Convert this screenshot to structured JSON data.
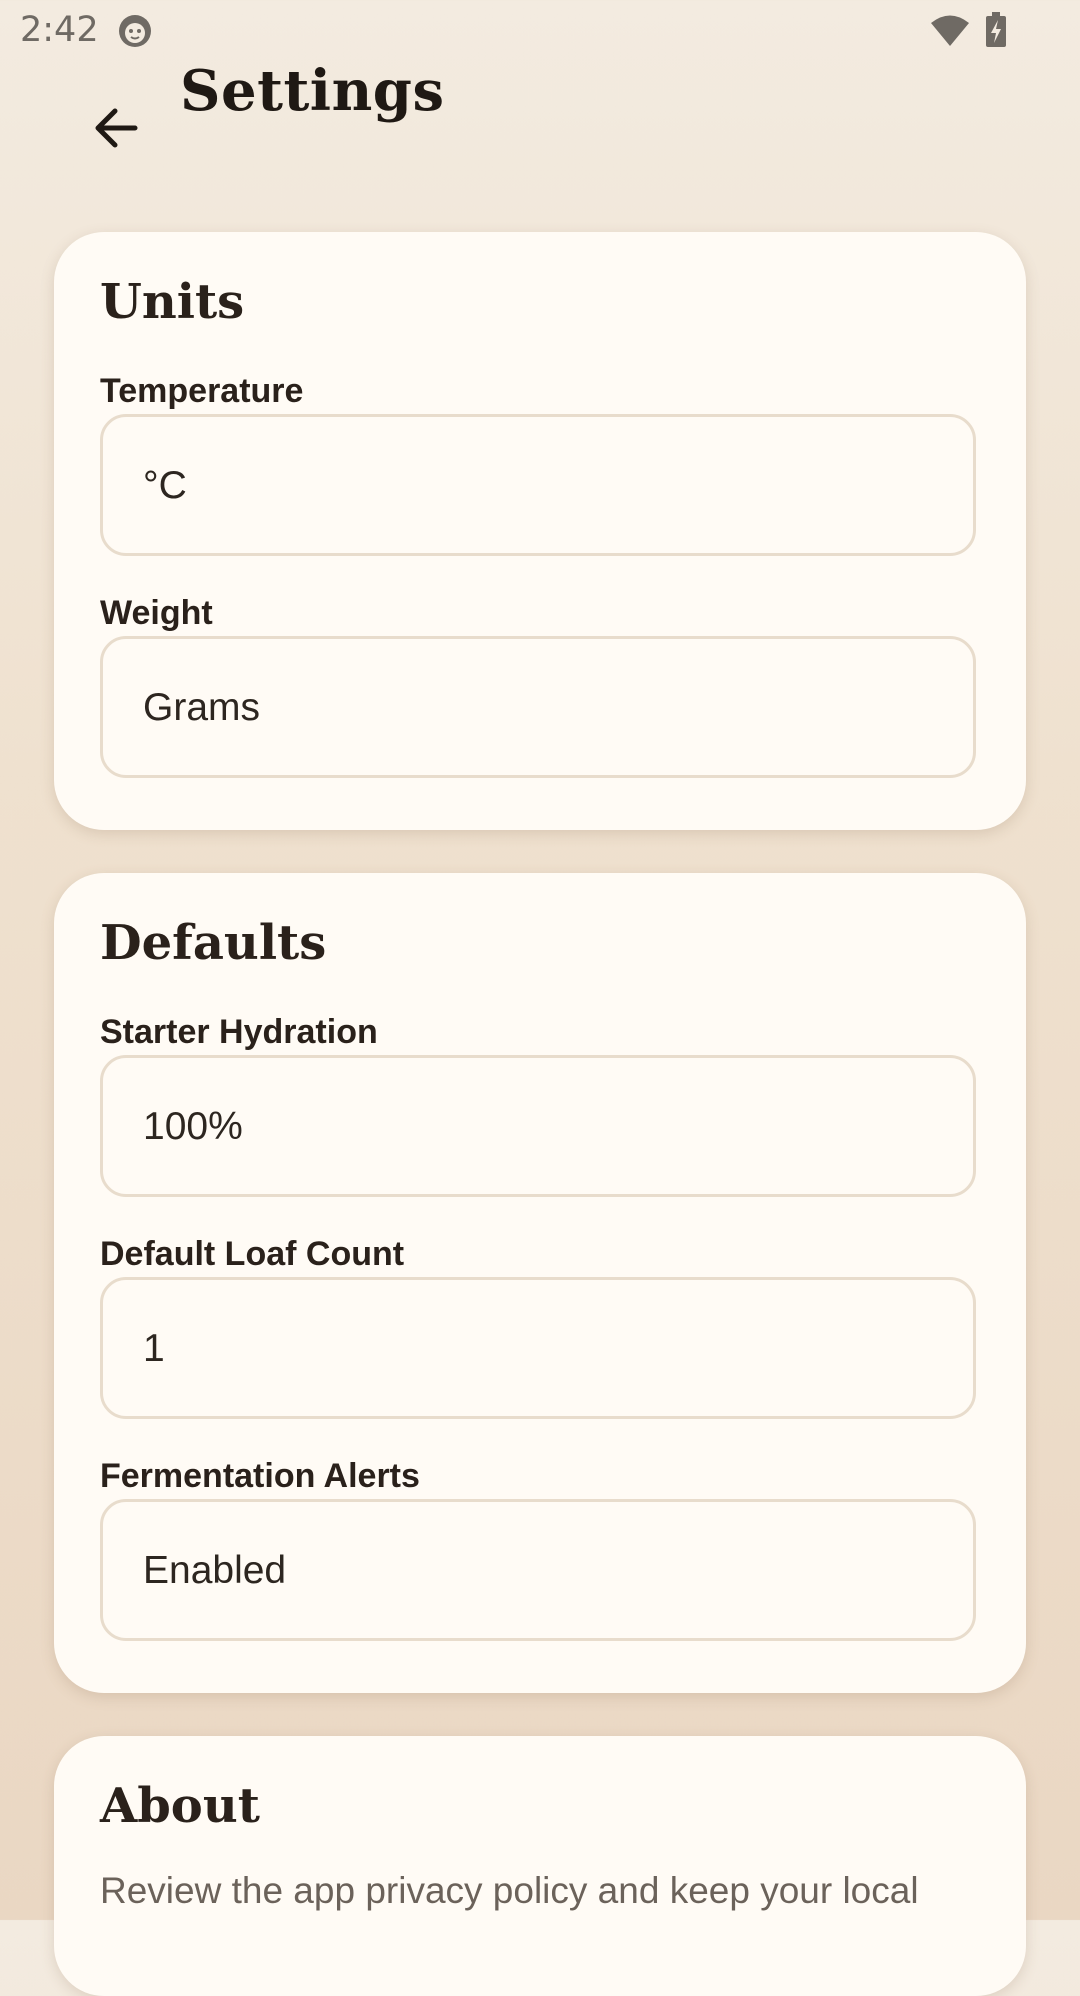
{
  "status_bar": {
    "time": "2:42",
    "icons": [
      "app-notification-icon",
      "wifi-icon",
      "battery-charging-icon"
    ]
  },
  "header": {
    "title": "Settings",
    "back_icon": "arrow-left-icon"
  },
  "sections": {
    "units": {
      "title": "Units",
      "temperature": {
        "label": "Temperature",
        "value": "°C"
      },
      "weight": {
        "label": "Weight",
        "value": "Grams"
      }
    },
    "defaults": {
      "title": "Defaults",
      "starter_hydration": {
        "label": "Starter Hydration",
        "value": "100%"
      },
      "default_loaf_count": {
        "label": "Default Loaf Count",
        "value": "1"
      },
      "fermentation_alerts": {
        "label": "Fermentation Alerts",
        "value": "Enabled"
      }
    },
    "about": {
      "title": "About",
      "text": "Review the app privacy policy and keep your local"
    }
  },
  "colors": {
    "background_top": "#f3ebe0",
    "background_bottom": "#ead7c3",
    "card": "#fffbf5",
    "field_border": "#e8dccc",
    "text_primary": "#2a211b",
    "text_secondary": "#6b625a"
  }
}
